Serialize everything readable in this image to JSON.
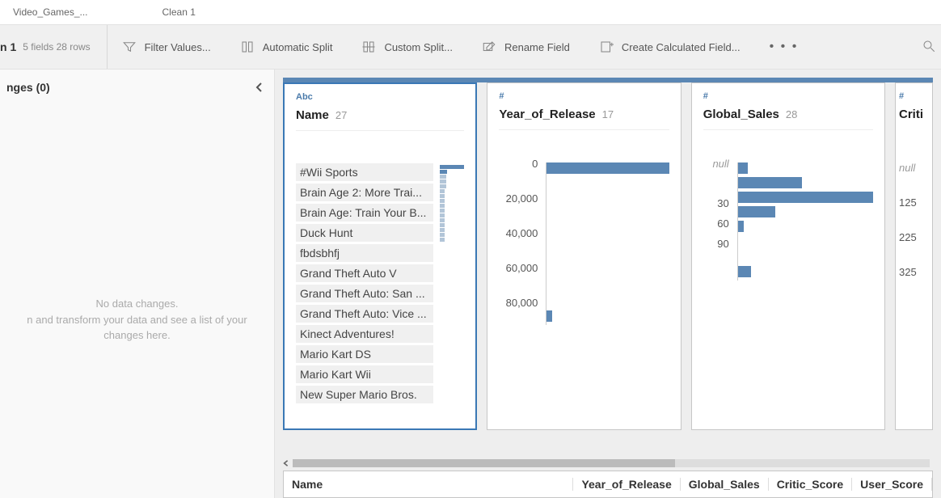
{
  "tabs": {
    "source": "Video_Games_...",
    "clean": "Clean 1"
  },
  "toolbar": {
    "title": "n 1",
    "meta": "5 fields  28 rows",
    "filter": "Filter Values...",
    "auto_split": "Automatic Split",
    "custom_split": "Custom Split...",
    "rename": "Rename Field",
    "calc": "Create Calculated Field...",
    "more": "• • •"
  },
  "left_panel": {
    "title": "nges (0)",
    "msg_line1": "No data changes.",
    "msg_line2": "n and transform your data and see a list of your",
    "msg_line3": "changes here."
  },
  "columns": {
    "name": {
      "dtype": "Abc",
      "label": "Name",
      "count": "27",
      "values": [
        "#Wii Sports",
        "Brain Age 2: More Trai...",
        "Brain Age: Train Your B...",
        "Duck Hunt",
        "fbdsbhfj",
        "Grand Theft Auto V",
        "Grand Theft Auto: San ...",
        "Grand Theft Auto: Vice ...",
        "Kinect Adventures!",
        "Mario Kart DS",
        "Mario Kart Wii",
        "New Super Mario Bros."
      ]
    },
    "year": {
      "dtype": "#",
      "label": "Year_of_Release",
      "count": "17",
      "ticks": [
        "0",
        "20,000",
        "40,000",
        "60,000",
        "80,000"
      ]
    },
    "global": {
      "dtype": "#",
      "label": "Global_Sales",
      "count": "28",
      "ticks": [
        "null",
        "30",
        "60",
        "90"
      ]
    },
    "critic": {
      "dtype": "#",
      "label": "Criti",
      "ticks": [
        "null",
        "125",
        "225",
        "325"
      ]
    }
  },
  "grid_header": {
    "name": "Name",
    "c1": "Year_of_Release",
    "c2": "Global_Sales",
    "c3": "Critic_Score",
    "c4": "User_Score"
  },
  "chart_data": [
    {
      "type": "bar",
      "field": "Year_of_Release",
      "orientation": "horizontal",
      "ylabel": "bin",
      "y_ticks": [
        0,
        20000,
        40000,
        60000,
        80000
      ],
      "bars": [
        {
          "bin": 0,
          "value": 27
        },
        {
          "bin": 80000,
          "value": 1
        }
      ],
      "note": "values are approximate row counts per bin read from bar lengths"
    },
    {
      "type": "bar",
      "field": "Global_Sales",
      "orientation": "horizontal",
      "y_ticks": [
        "null",
        30,
        60,
        90
      ],
      "bars": [
        {
          "bin": "null",
          "value": 1
        },
        {
          "bin": 0,
          "value": 12
        },
        {
          "bin": 15,
          "value": 27
        },
        {
          "bin": 30,
          "value": 7
        },
        {
          "bin": 45,
          "value": 1
        },
        {
          "bin": 90,
          "value": 2
        }
      ],
      "note": "approximate counts estimated from relative bar widths"
    },
    {
      "type": "bar",
      "field": "Critic_Score (partial)",
      "orientation": "horizontal",
      "y_ticks": [
        "null",
        125,
        225,
        325
      ]
    }
  ]
}
